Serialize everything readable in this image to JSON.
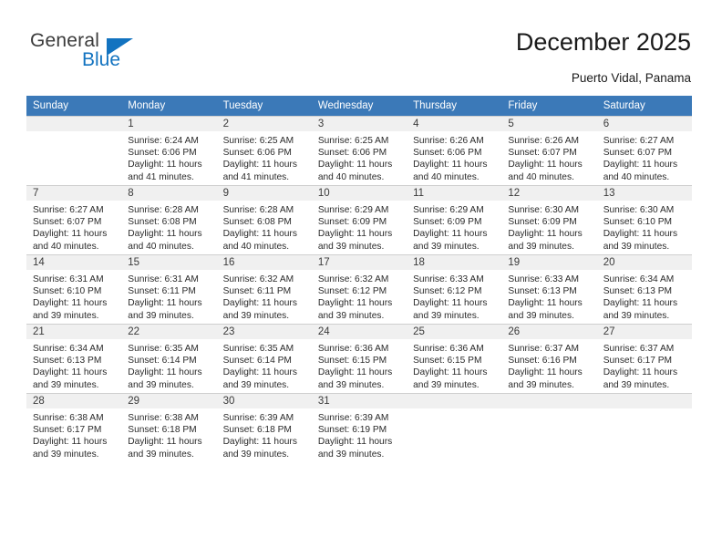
{
  "brand": {
    "name_part1": "General",
    "name_part2": "Blue"
  },
  "header": {
    "title": "December 2025",
    "location": "Puerto Vidal, Panama"
  },
  "weekday_headers": [
    "Sunday",
    "Monday",
    "Tuesday",
    "Wednesday",
    "Thursday",
    "Friday",
    "Saturday"
  ],
  "labels": {
    "sunrise_prefix": "Sunrise:",
    "sunset_prefix": "Sunset:",
    "daylight_prefix": "Daylight:"
  },
  "colors": {
    "header_blue": "#3b79b8",
    "brand_blue": "#1273c0",
    "daynum_band": "#f0f0f0",
    "grid_line": "#cfcfcf"
  },
  "weeks": [
    [
      {
        "day": "",
        "empty": true
      },
      {
        "day": "1",
        "sunrise": "Sunrise: 6:24 AM",
        "sunset": "Sunset: 6:06 PM",
        "daylight_line1": "Daylight: 11 hours",
        "daylight_line2": "and 41 minutes."
      },
      {
        "day": "2",
        "sunrise": "Sunrise: 6:25 AM",
        "sunset": "Sunset: 6:06 PM",
        "daylight_line1": "Daylight: 11 hours",
        "daylight_line2": "and 41 minutes."
      },
      {
        "day": "3",
        "sunrise": "Sunrise: 6:25 AM",
        "sunset": "Sunset: 6:06 PM",
        "daylight_line1": "Daylight: 11 hours",
        "daylight_line2": "and 40 minutes."
      },
      {
        "day": "4",
        "sunrise": "Sunrise: 6:26 AM",
        "sunset": "Sunset: 6:06 PM",
        "daylight_line1": "Daylight: 11 hours",
        "daylight_line2": "and 40 minutes."
      },
      {
        "day": "5",
        "sunrise": "Sunrise: 6:26 AM",
        "sunset": "Sunset: 6:07 PM",
        "daylight_line1": "Daylight: 11 hours",
        "daylight_line2": "and 40 minutes."
      },
      {
        "day": "6",
        "sunrise": "Sunrise: 6:27 AM",
        "sunset": "Sunset: 6:07 PM",
        "daylight_line1": "Daylight: 11 hours",
        "daylight_line2": "and 40 minutes."
      }
    ],
    [
      {
        "day": "7",
        "sunrise": "Sunrise: 6:27 AM",
        "sunset": "Sunset: 6:07 PM",
        "daylight_line1": "Daylight: 11 hours",
        "daylight_line2": "and 40 minutes."
      },
      {
        "day": "8",
        "sunrise": "Sunrise: 6:28 AM",
        "sunset": "Sunset: 6:08 PM",
        "daylight_line1": "Daylight: 11 hours",
        "daylight_line2": "and 40 minutes."
      },
      {
        "day": "9",
        "sunrise": "Sunrise: 6:28 AM",
        "sunset": "Sunset: 6:08 PM",
        "daylight_line1": "Daylight: 11 hours",
        "daylight_line2": "and 40 minutes."
      },
      {
        "day": "10",
        "sunrise": "Sunrise: 6:29 AM",
        "sunset": "Sunset: 6:09 PM",
        "daylight_line1": "Daylight: 11 hours",
        "daylight_line2": "and 39 minutes."
      },
      {
        "day": "11",
        "sunrise": "Sunrise: 6:29 AM",
        "sunset": "Sunset: 6:09 PM",
        "daylight_line1": "Daylight: 11 hours",
        "daylight_line2": "and 39 minutes."
      },
      {
        "day": "12",
        "sunrise": "Sunrise: 6:30 AM",
        "sunset": "Sunset: 6:09 PM",
        "daylight_line1": "Daylight: 11 hours",
        "daylight_line2": "and 39 minutes."
      },
      {
        "day": "13",
        "sunrise": "Sunrise: 6:30 AM",
        "sunset": "Sunset: 6:10 PM",
        "daylight_line1": "Daylight: 11 hours",
        "daylight_line2": "and 39 minutes."
      }
    ],
    [
      {
        "day": "14",
        "sunrise": "Sunrise: 6:31 AM",
        "sunset": "Sunset: 6:10 PM",
        "daylight_line1": "Daylight: 11 hours",
        "daylight_line2": "and 39 minutes."
      },
      {
        "day": "15",
        "sunrise": "Sunrise: 6:31 AM",
        "sunset": "Sunset: 6:11 PM",
        "daylight_line1": "Daylight: 11 hours",
        "daylight_line2": "and 39 minutes."
      },
      {
        "day": "16",
        "sunrise": "Sunrise: 6:32 AM",
        "sunset": "Sunset: 6:11 PM",
        "daylight_line1": "Daylight: 11 hours",
        "daylight_line2": "and 39 minutes."
      },
      {
        "day": "17",
        "sunrise": "Sunrise: 6:32 AM",
        "sunset": "Sunset: 6:12 PM",
        "daylight_line1": "Daylight: 11 hours",
        "daylight_line2": "and 39 minutes."
      },
      {
        "day": "18",
        "sunrise": "Sunrise: 6:33 AM",
        "sunset": "Sunset: 6:12 PM",
        "daylight_line1": "Daylight: 11 hours",
        "daylight_line2": "and 39 minutes."
      },
      {
        "day": "19",
        "sunrise": "Sunrise: 6:33 AM",
        "sunset": "Sunset: 6:13 PM",
        "daylight_line1": "Daylight: 11 hours",
        "daylight_line2": "and 39 minutes."
      },
      {
        "day": "20",
        "sunrise": "Sunrise: 6:34 AM",
        "sunset": "Sunset: 6:13 PM",
        "daylight_line1": "Daylight: 11 hours",
        "daylight_line2": "and 39 minutes."
      }
    ],
    [
      {
        "day": "21",
        "sunrise": "Sunrise: 6:34 AM",
        "sunset": "Sunset: 6:13 PM",
        "daylight_line1": "Daylight: 11 hours",
        "daylight_line2": "and 39 minutes."
      },
      {
        "day": "22",
        "sunrise": "Sunrise: 6:35 AM",
        "sunset": "Sunset: 6:14 PM",
        "daylight_line1": "Daylight: 11 hours",
        "daylight_line2": "and 39 minutes."
      },
      {
        "day": "23",
        "sunrise": "Sunrise: 6:35 AM",
        "sunset": "Sunset: 6:14 PM",
        "daylight_line1": "Daylight: 11 hours",
        "daylight_line2": "and 39 minutes."
      },
      {
        "day": "24",
        "sunrise": "Sunrise: 6:36 AM",
        "sunset": "Sunset: 6:15 PM",
        "daylight_line1": "Daylight: 11 hours",
        "daylight_line2": "and 39 minutes."
      },
      {
        "day": "25",
        "sunrise": "Sunrise: 6:36 AM",
        "sunset": "Sunset: 6:15 PM",
        "daylight_line1": "Daylight: 11 hours",
        "daylight_line2": "and 39 minutes."
      },
      {
        "day": "26",
        "sunrise": "Sunrise: 6:37 AM",
        "sunset": "Sunset: 6:16 PM",
        "daylight_line1": "Daylight: 11 hours",
        "daylight_line2": "and 39 minutes."
      },
      {
        "day": "27",
        "sunrise": "Sunrise: 6:37 AM",
        "sunset": "Sunset: 6:17 PM",
        "daylight_line1": "Daylight: 11 hours",
        "daylight_line2": "and 39 minutes."
      }
    ],
    [
      {
        "day": "28",
        "sunrise": "Sunrise: 6:38 AM",
        "sunset": "Sunset: 6:17 PM",
        "daylight_line1": "Daylight: 11 hours",
        "daylight_line2": "and 39 minutes."
      },
      {
        "day": "29",
        "sunrise": "Sunrise: 6:38 AM",
        "sunset": "Sunset: 6:18 PM",
        "daylight_line1": "Daylight: 11 hours",
        "daylight_line2": "and 39 minutes."
      },
      {
        "day": "30",
        "sunrise": "Sunrise: 6:39 AM",
        "sunset": "Sunset: 6:18 PM",
        "daylight_line1": "Daylight: 11 hours",
        "daylight_line2": "and 39 minutes."
      },
      {
        "day": "31",
        "sunrise": "Sunrise: 6:39 AM",
        "sunset": "Sunset: 6:19 PM",
        "daylight_line1": "Daylight: 11 hours",
        "daylight_line2": "and 39 minutes."
      },
      {
        "day": "",
        "empty": true
      },
      {
        "day": "",
        "empty": true
      },
      {
        "day": "",
        "empty": true
      }
    ]
  ]
}
